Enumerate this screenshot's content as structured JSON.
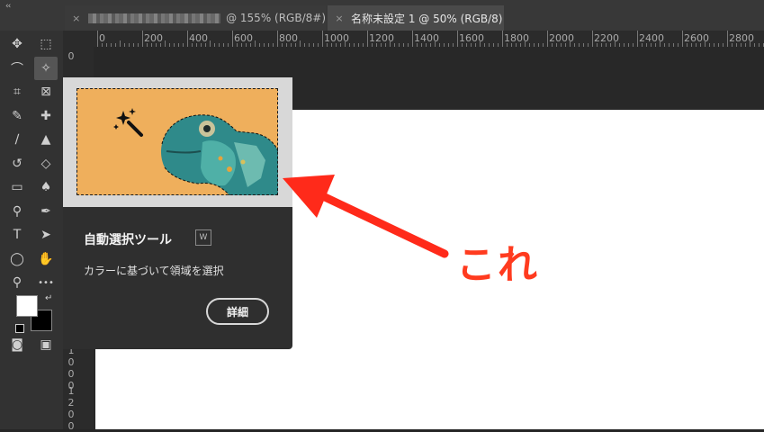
{
  "window": {
    "collapse_glyph": "‹‹",
    "tabs": [
      {
        "label": "@ 155% (RGB/8#)",
        "close": "×",
        "blurred_prefix": true
      },
      {
        "label": "名称未設定 1 @ 50% (RGB/8)",
        "close": "×",
        "active": true
      }
    ]
  },
  "ruler": {
    "top_labels": [
      "0",
      "200",
      "400",
      "600",
      "800",
      "1000",
      "1200",
      "1400",
      "1600",
      "1800",
      "2000",
      "2200",
      "2400",
      "2600",
      "2800"
    ],
    "left_digits_a": [
      "0"
    ],
    "left_digits_b": [
      "1",
      "0",
      "0",
      "0"
    ],
    "left_digits_c": [
      "1",
      "2",
      "0",
      "0"
    ]
  },
  "toolbar": {
    "tools": [
      {
        "name": "move-tool",
        "glyph": "✥"
      },
      {
        "name": "marquee-tool",
        "glyph": "⬚"
      },
      {
        "name": "lasso-tool",
        "glyph": "⌒"
      },
      {
        "name": "magic-wand-tool",
        "glyph": "✧"
      },
      {
        "name": "crop-tool",
        "glyph": "⌗"
      },
      {
        "name": "frame-tool",
        "glyph": "⊠"
      },
      {
        "name": "eyedropper-tool",
        "glyph": "✎"
      },
      {
        "name": "healing-brush-tool",
        "glyph": "✚"
      },
      {
        "name": "brush-tool",
        "glyph": "∕"
      },
      {
        "name": "clone-stamp-tool",
        "glyph": "▲"
      },
      {
        "name": "history-brush-tool",
        "glyph": "↺"
      },
      {
        "name": "eraser-tool",
        "glyph": "◇"
      },
      {
        "name": "gradient-tool",
        "glyph": "▭"
      },
      {
        "name": "blur-tool",
        "glyph": "♠"
      },
      {
        "name": "dodge-tool",
        "glyph": "⚲"
      },
      {
        "name": "pen-tool",
        "glyph": "✒"
      },
      {
        "name": "type-tool",
        "glyph": "T"
      },
      {
        "name": "path-selection-tool",
        "glyph": "➤"
      },
      {
        "name": "ellipse-tool",
        "glyph": "◯"
      },
      {
        "name": "hand-tool",
        "glyph": "✋"
      },
      {
        "name": "zoom-tool",
        "glyph": "⚲"
      },
      {
        "name": "more-tools",
        "glyph": "•••"
      },
      {
        "name": "quick-mask",
        "glyph": "◙"
      },
      {
        "name": "screen-mode",
        "glyph": "▣"
      }
    ],
    "swap_glyph": "↵",
    "foreground_color": "#ffffff",
    "background_color": "#000000"
  },
  "tooltip": {
    "title": "自動選択ツール",
    "shortcut": "W",
    "description": "カラーに基づいて領域を選択",
    "button": "詳細",
    "image_bg": "#efaf5c"
  },
  "annotation": {
    "text": "これ",
    "color": "#ff3b1f"
  }
}
